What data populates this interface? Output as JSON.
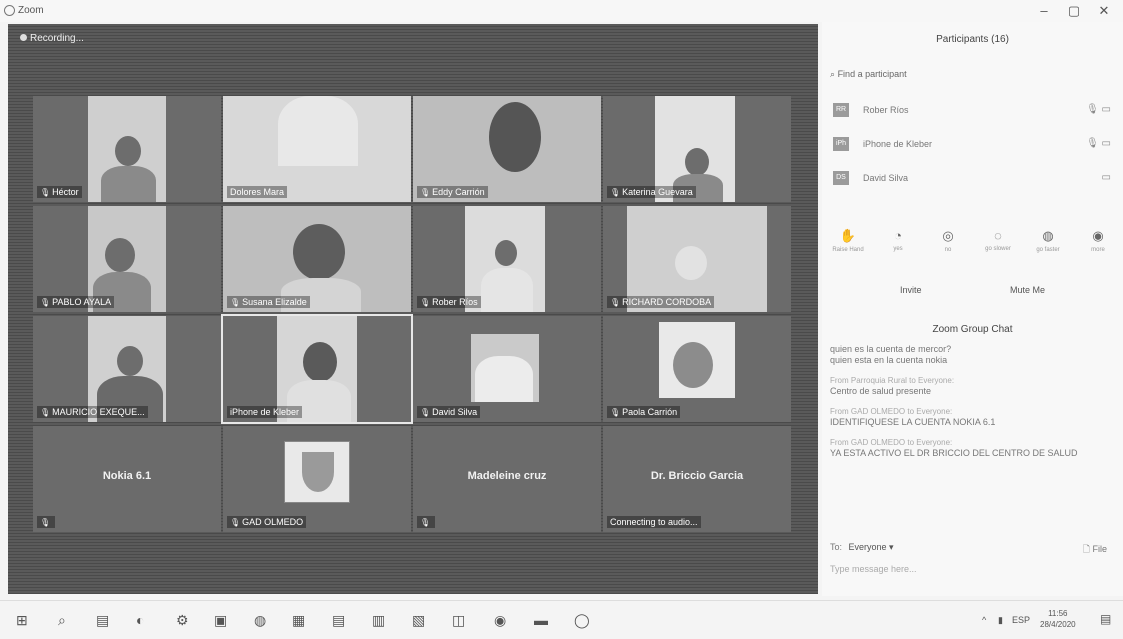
{
  "window": {
    "title": "Zoom",
    "controls": [
      "–",
      "▢",
      "✕"
    ]
  },
  "recording_label": "Recording...",
  "tiles": [
    {
      "name": "Héctor"
    },
    {
      "name": "Dolores Mara"
    },
    {
      "name": "Eddy Carrión"
    },
    {
      "name": "Katerina Guevara"
    },
    {
      "name": "PABLO AYALA"
    },
    {
      "name": "Susana Elizalde"
    },
    {
      "name": "Rober Ríos"
    },
    {
      "name": "RICHARD CORDOBA"
    },
    {
      "name": "MAURICIO EXEQUE..."
    },
    {
      "name": "iPhone de Kleber"
    },
    {
      "name": "David Silva"
    },
    {
      "name": "Paola Carrión"
    },
    {
      "center_name": "Nokia 6.1"
    },
    {
      "name": "GAD OLMEDO"
    },
    {
      "center_name": "Madeleine cruz"
    },
    {
      "center_name": "Dr. Briccio Garcia",
      "status": "Connecting to audio..."
    }
  ],
  "panel": {
    "title": "Participants (16)",
    "find_placeholder": "Find a participant",
    "participants": [
      {
        "initials": "RR",
        "name": "Rober Ríos",
        "icons": "🎙 ▭"
      },
      {
        "initials": "iPh",
        "name": "iPhone de Kleber",
        "icons": "🎙 ▭"
      },
      {
        "initials": "DS",
        "name": "David Silva",
        "icons": "▭"
      }
    ],
    "tools": [
      {
        "icon": "✋",
        "label": "Raise Hand"
      },
      {
        "icon": "◔",
        "label": "yes"
      },
      {
        "icon": "◎",
        "label": "no"
      },
      {
        "icon": "◌",
        "label": "go slower"
      },
      {
        "icon": "◍",
        "label": "go faster"
      },
      {
        "icon": "◉",
        "label": "more"
      }
    ],
    "invite_label": "Invite",
    "mute_me_label": "Mute Me",
    "chat_title": "Zoom Group Chat",
    "chat": [
      {
        "msg": "quien es la cuenta de mercor?"
      },
      {
        "msg": "quien esta en la cuenta nokia"
      },
      {
        "from": "From Parroquia Rural to Everyone:",
        "msg": "Centro de salud presente"
      },
      {
        "from": "From GAD OLMEDO to Everyone:",
        "msg": "IDENTIFIQUESE LA CUENTA NOKIA 6.1"
      },
      {
        "from": "From GAD OLMEDO to Everyone:",
        "msg": "YA ESTA ACTIVO EL DR BRICCIO DEL CENTRO DE SALUD"
      }
    ],
    "to_label": "To:",
    "to_value": "Everyone ▾",
    "file_label": "File",
    "type_placeholder": "Type message here..."
  },
  "taskbar": {
    "icons": [
      "⊞",
      "⌕",
      "▤",
      "◐",
      "⚙",
      "▣",
      "◍",
      "▦",
      "▤",
      "▥",
      "▧",
      "◫",
      "◉",
      "▬",
      "◯"
    ],
    "tray": {
      "arrow": "^",
      "lang": "ESP",
      "time": "11:56",
      "date": "28/4/2020",
      "notif": "▤"
    }
  }
}
